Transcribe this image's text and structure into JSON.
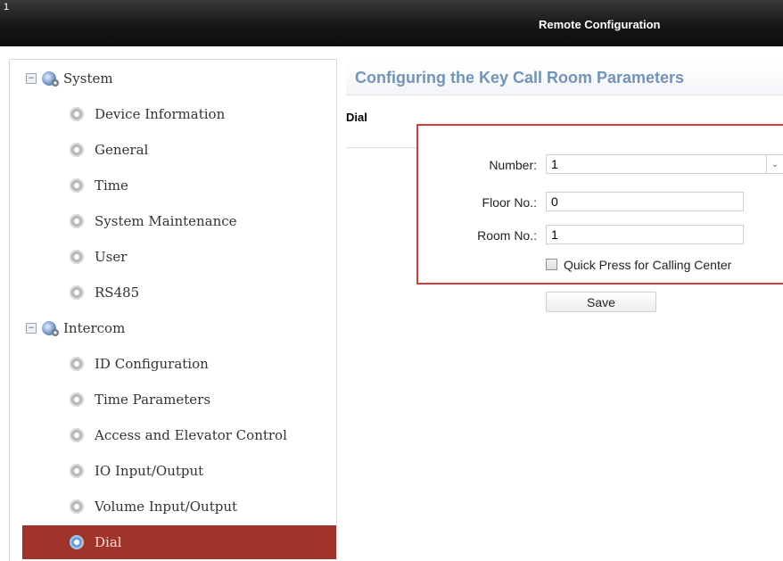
{
  "window": {
    "number": "1",
    "title": "Remote Configuration"
  },
  "sidebar": {
    "groups": [
      {
        "label": "System",
        "toggle": "−",
        "items": [
          {
            "label": "Device Information"
          },
          {
            "label": "General"
          },
          {
            "label": "Time"
          },
          {
            "label": "System Maintenance"
          },
          {
            "label": "User"
          },
          {
            "label": "RS485"
          }
        ]
      },
      {
        "label": "Intercom",
        "toggle": "−",
        "items": [
          {
            "label": "ID Configuration"
          },
          {
            "label": "Time Parameters"
          },
          {
            "label": "Access and Elevator Control"
          },
          {
            "label": "IO Input/Output"
          },
          {
            "label": "Volume Input/Output"
          },
          {
            "label": "Dial",
            "selected": true
          }
        ]
      }
    ]
  },
  "main": {
    "title": "Configuring the Key Call Room Parameters",
    "section": "Dial",
    "form": {
      "number_label": "Number:",
      "number_value": "1",
      "floor_label": "Floor No.:",
      "floor_value": "0",
      "room_label": "Room No.:",
      "room_value": "1",
      "quick_press_label": "Quick Press for Calling Center",
      "quick_press_checked": false
    },
    "save_label": "Save"
  },
  "colors": {
    "selected_bg": "#a0342a",
    "title_blue": "#7393b8",
    "highlight_red": "#d63a3a"
  }
}
